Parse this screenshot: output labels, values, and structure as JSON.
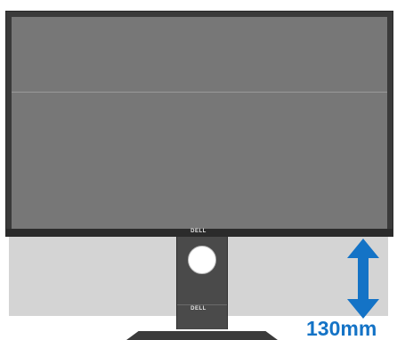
{
  "brand": {
    "logo_text": "DELL"
  },
  "adjustment": {
    "height_label": "130mm",
    "arrow_icon": "double-vertical-arrow-icon",
    "arrow_color": "#1473c6"
  },
  "colors": {
    "monitor_body": "#3a3a3a",
    "screen": "#777777",
    "ghost_position": "#d4d4d4",
    "stand": "#4a4a4a"
  }
}
